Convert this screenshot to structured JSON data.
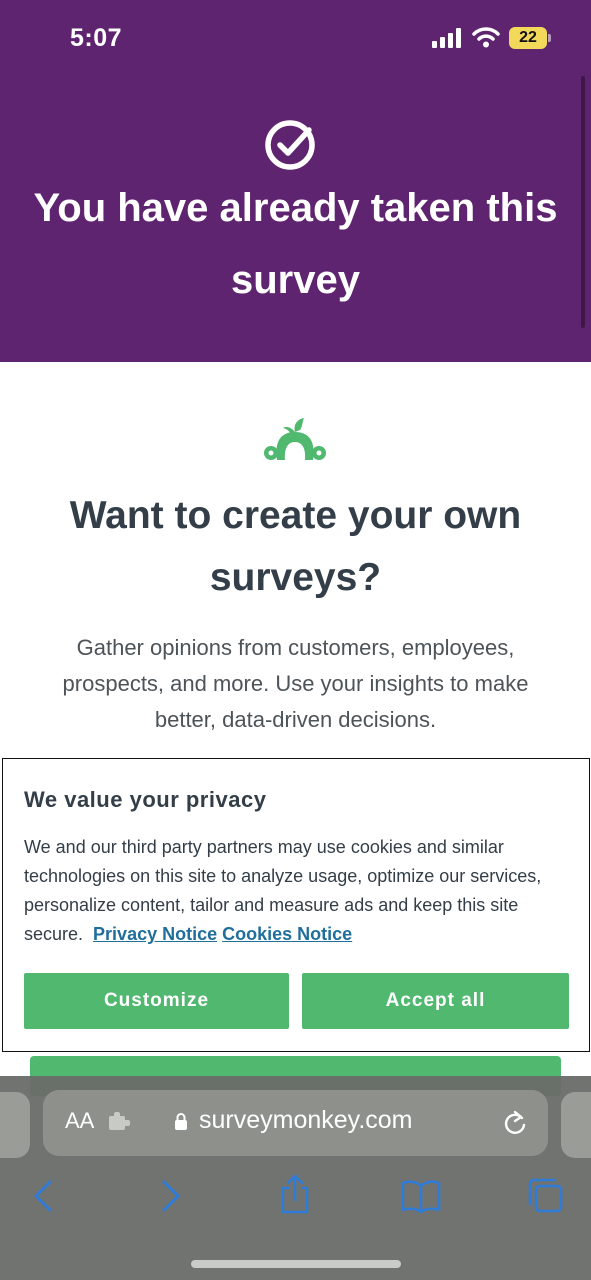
{
  "status_bar": {
    "time": "5:07",
    "battery": "22"
  },
  "hero": {
    "title": "You have already taken this survey"
  },
  "promo": {
    "title": "Want to create your own surveys?",
    "text": "Gather opinions from customers, employees, prospects, and more. Use your insights to make better, data-driven decisions."
  },
  "cookie": {
    "title": "We value your privacy",
    "text": "We and our third party partners may use cookies and similar technologies on this site to analyze usage, optimize our services, personalize content, tailor and measure ads and keep this site secure.",
    "privacy_link": "Privacy Notice",
    "cookies_link": "Cookies Notice",
    "customize_label": "Customize",
    "accept_label": "Accept all"
  },
  "browser": {
    "aa_label": "AA",
    "url": "surveymonkey.com"
  },
  "colors": {
    "header_purple": "#5f246f",
    "brand_green": "#50b86f",
    "link_blue": "#1f6e9c",
    "heading_text": "#333e48"
  },
  "icons": [
    "check-circle-icon",
    "surveymonkey-logo-icon",
    "signal-icon",
    "wifi-icon",
    "battery-icon",
    "extension-icon",
    "lock-icon",
    "reload-icon",
    "back-icon",
    "forward-icon",
    "share-icon",
    "bookmarks-icon",
    "tabs-icon"
  ]
}
